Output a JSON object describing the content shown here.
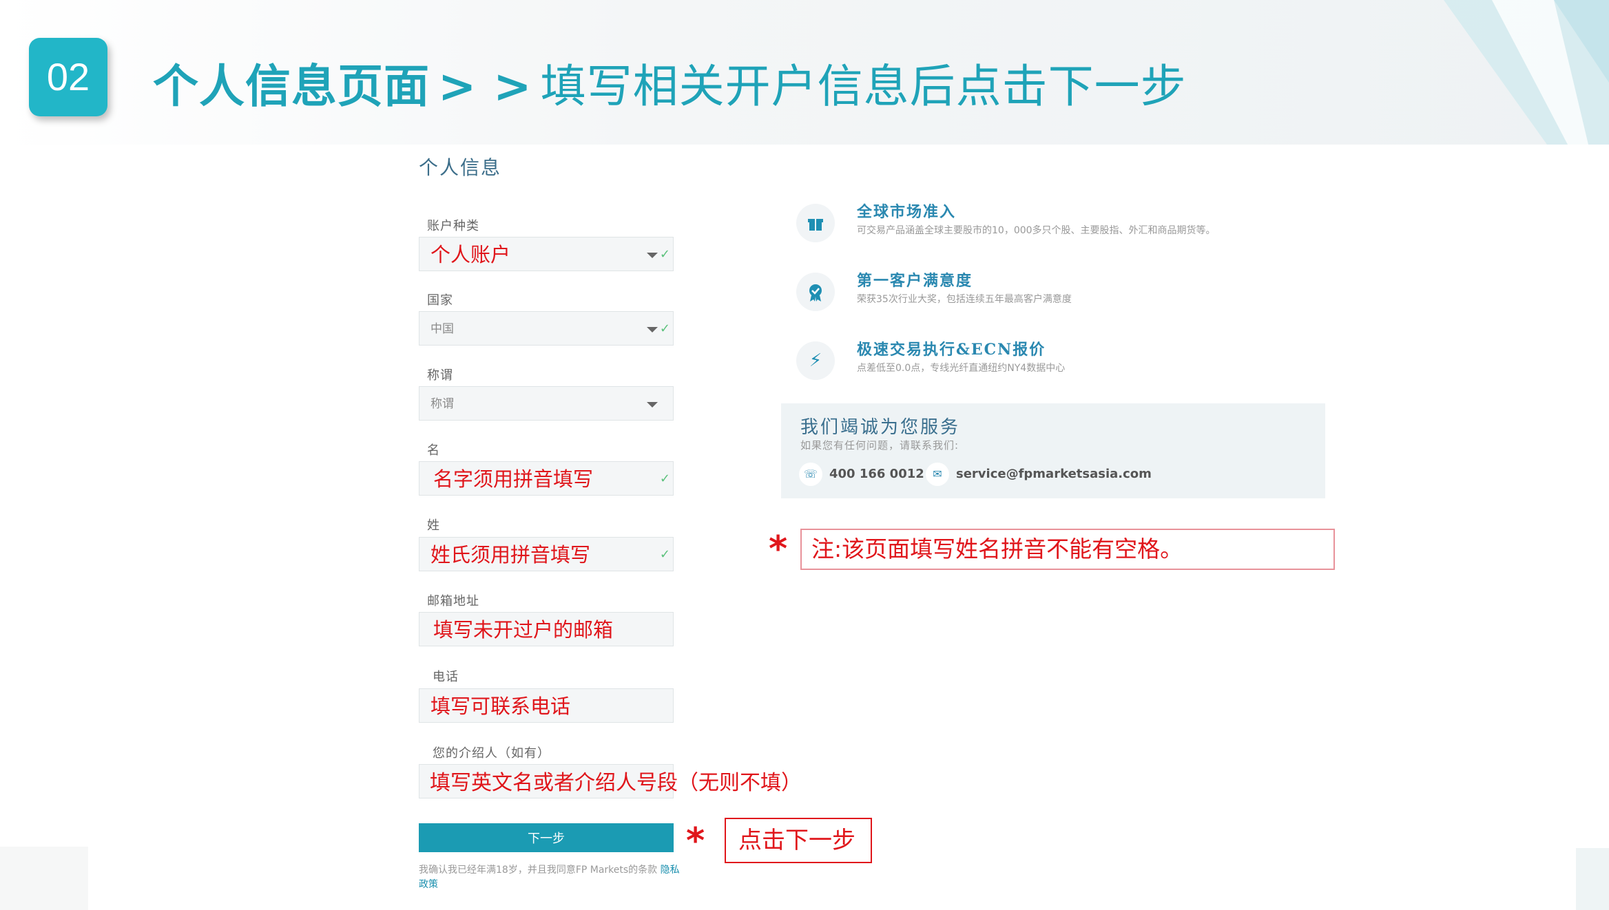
{
  "slide": {
    "step_number": "02",
    "title_main": "个人信息页面",
    "title_arrows": "> >",
    "title_sub": "填写相关开户信息后点击下一步"
  },
  "form": {
    "section_title": "个人信息",
    "fields": [
      {
        "label": "账户种类",
        "value": "个人账户",
        "type": "select"
      },
      {
        "label": "国家",
        "value": "中国",
        "type": "select"
      },
      {
        "label": "称谓",
        "value": "称谓",
        "type": "select"
      },
      {
        "label": "名",
        "value": "名字须用拼音填写",
        "type": "text"
      },
      {
        "label": "姓",
        "value": "姓氏须用拼音填写",
        "type": "text"
      },
      {
        "label": "邮箱地址",
        "value": "填写未开过户的邮箱",
        "type": "text"
      },
      {
        "label": "电话",
        "value": "填写可联系电话",
        "type": "text"
      },
      {
        "label": "您的介绍人（如有）",
        "value": "填写英文名或者介绍人号段（无则不填）",
        "type": "text"
      }
    ],
    "next_button": "下一步",
    "consent_text": "我确认我已经年满18岁，并且我同意FP Markets的条款",
    "privacy_link": "隐私政策"
  },
  "features": [
    {
      "icon": "gift-icon",
      "title": "全球市场准入",
      "desc": "可交易产品涵盖全球主要股市的10，000多只个股、主要股指、外汇和商品期货等。"
    },
    {
      "icon": "award-ribbon-icon",
      "title": "第一客户满意度",
      "desc": "荣获35次行业大奖，包括连续五年最高客户满意度"
    },
    {
      "icon": "lightning-icon",
      "title": "极速交易执行&ECN报价",
      "desc": "点差低至0.0点，专线光纤直通纽约NY4数据中心"
    }
  ],
  "contact": {
    "title": "我们竭诚为您服务",
    "subtitle": "如果您有任何问题，请联系我们:",
    "phone": "400 166 0012",
    "email": "service@fpmarketsasia.com"
  },
  "annotations": {
    "note": "注:该页面填写姓名拼音不能有空格。",
    "click_next": "点击下一步",
    "star": "*"
  },
  "colors": {
    "accent": "#22b6c8",
    "title": "#1fa3b8",
    "annotation_red": "#e0161b",
    "button": "#1b9bb3"
  }
}
